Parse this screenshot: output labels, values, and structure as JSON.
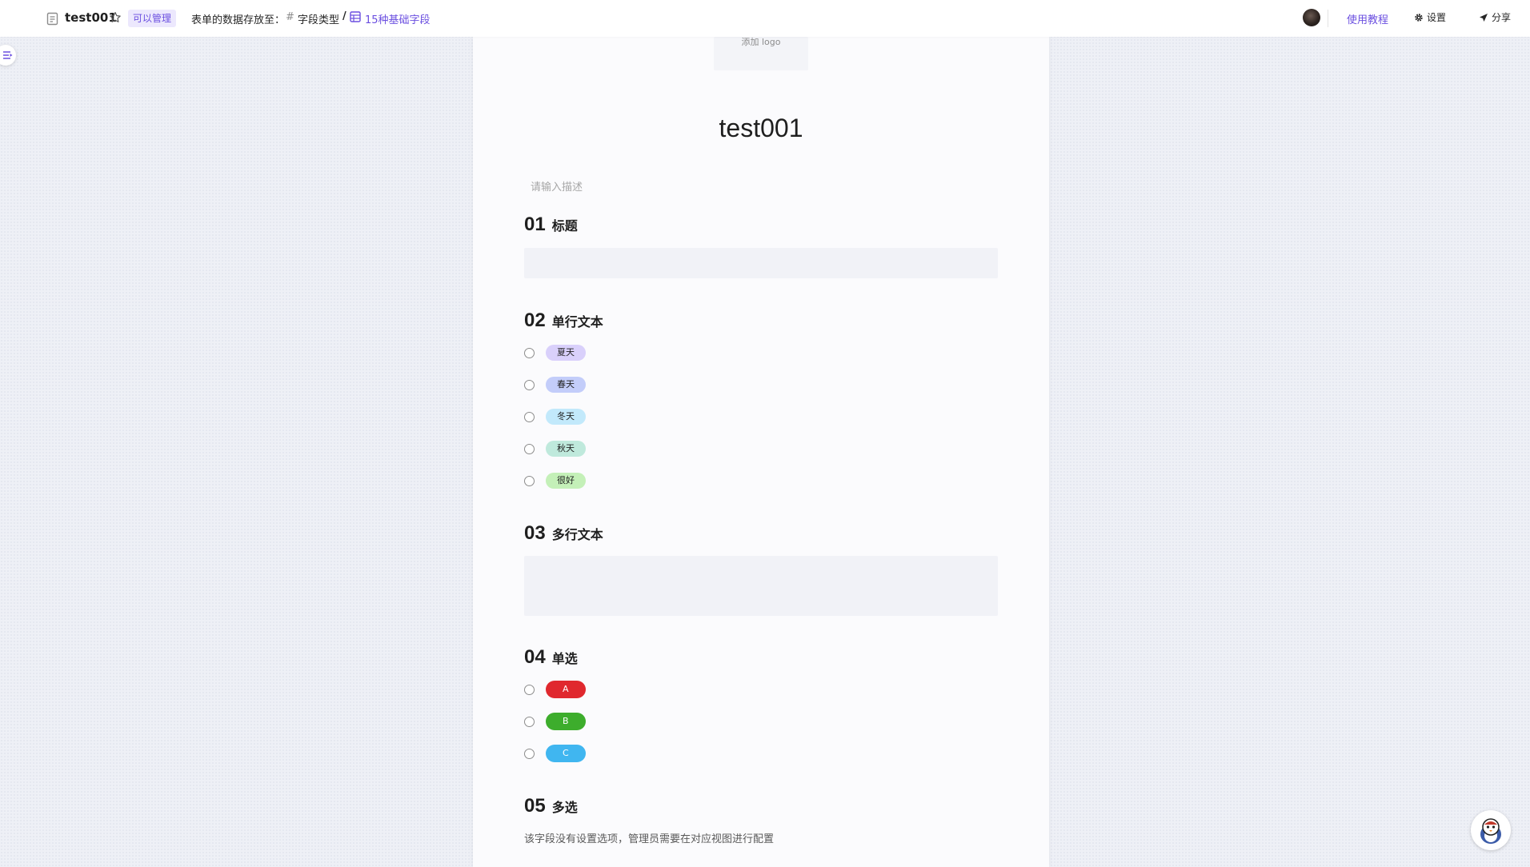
{
  "header": {
    "form_name": "test001",
    "permission_badge": "可以管理",
    "storage_label": "表单的数据存放至：",
    "folder_name": "字段类型",
    "separator": "/",
    "sheet_name": "15种基础字段",
    "tutorial_link": "使用教程",
    "settings_label": "设置",
    "share_label": "分享"
  },
  "form": {
    "logo_placeholder": "添加 logo",
    "title": "test001",
    "description_placeholder": "请输入描述",
    "questions": [
      {
        "number": "01",
        "label": "标题"
      },
      {
        "number": "02",
        "label": "单行文本",
        "options": [
          {
            "label": "夏天",
            "color": "#d9d0fb"
          },
          {
            "label": "春天",
            "color": "#c3cdfa"
          },
          {
            "label": "冬天",
            "color": "#c2e9fb"
          },
          {
            "label": "秋天",
            "color": "#bfe9dc"
          },
          {
            "label": "很好",
            "color": "#c4f0b8"
          }
        ]
      },
      {
        "number": "03",
        "label": "多行文本"
      },
      {
        "number": "04",
        "label": "单选",
        "options": [
          {
            "label": "A",
            "color": "#e0282e"
          },
          {
            "label": "B",
            "color": "#3dad2c"
          },
          {
            "label": "C",
            "color": "#40b6f0"
          }
        ]
      },
      {
        "number": "05",
        "label": "多选",
        "hint": "该字段没有设置选项，管理员需要在对应视图进行配置"
      }
    ]
  },
  "colors": {
    "accent": "#6b4fe0"
  },
  "icons": [
    "form-icon",
    "star-icon",
    "hash-icon",
    "sheet-icon",
    "gear-icon",
    "send-icon",
    "sidebar-menu-icon",
    "mascot-icon"
  ]
}
